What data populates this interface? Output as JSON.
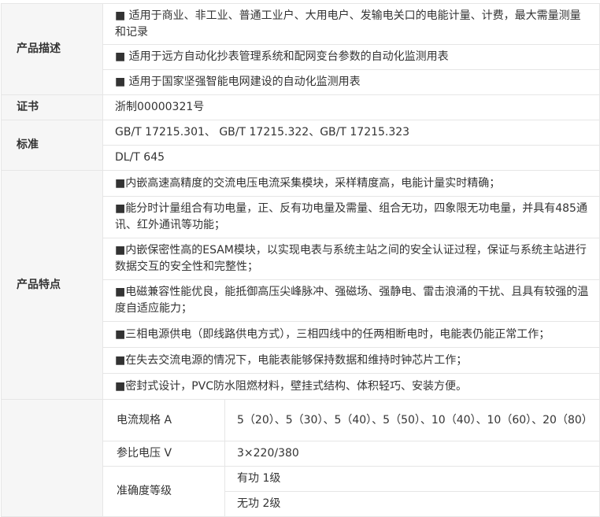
{
  "rows": {
    "desc_label": "产品描述",
    "desc_1": "■ 适用于商业、非工业、普通工业户、大用电户、发输电关口的电能计量、计费，最大需量测量和记录",
    "desc_2": "■ 适用于远方自动化抄表管理系统和配网变台参数的自动化监测用表",
    "desc_3": "■ 适用于国家坚强智能电网建设的自动化监测用表",
    "cert_label": "证书",
    "cert_value": "浙制00000321号",
    "std_label": "标准",
    "std_1": "GB/T 17215.301、 GB/T 17215.322、GB/T 17215.323",
    "std_2": "DL/T 645",
    "feat_label": "产品特点",
    "feat_1": "■内嵌高速高精度的交流电压电流采集模块，采样精度高，电能计量实时精确；",
    "feat_2": "■能分时计量组合有功电量，正、反有功电量及需量、组合无功，四象限无功电量，并具有485通讯、红外通讯等功能；",
    "feat_3": "■内嵌保密性高的ESAM模块，以实现电表与系统主站之间的安全认证过程，保证与系统主站进行数据交互的安全性和完整性；",
    "feat_4": "■电磁兼容性能优良，能抵御高压尖峰脉冲、强磁场、强静电、雷击浪涌的干扰、且具有较强的温度自适应能力；",
    "feat_5": "■三相电源供电（即线路供电方式），三相四线中的任两相断电时，电能表仍能正常工作；",
    "feat_6": "■在失去交流电源的情况下，电能表能够保持数据和维持时钟芯片工作；",
    "feat_7": "■密封式设计，PVC防水阻燃材料，壁挂式结构、体积轻巧、安装方便。",
    "spec_current_label": "电流规格 A",
    "spec_current_value": "5（20）、5（30）、5（40）、5（50）、10（40）、10（60）、20（80）",
    "spec_voltage_label": "参比电压 V",
    "spec_voltage_value": "3×220/380",
    "spec_accuracy_label": "准确度等级",
    "spec_accuracy_1": "有功 1级",
    "spec_accuracy_2": "无功 2级"
  }
}
